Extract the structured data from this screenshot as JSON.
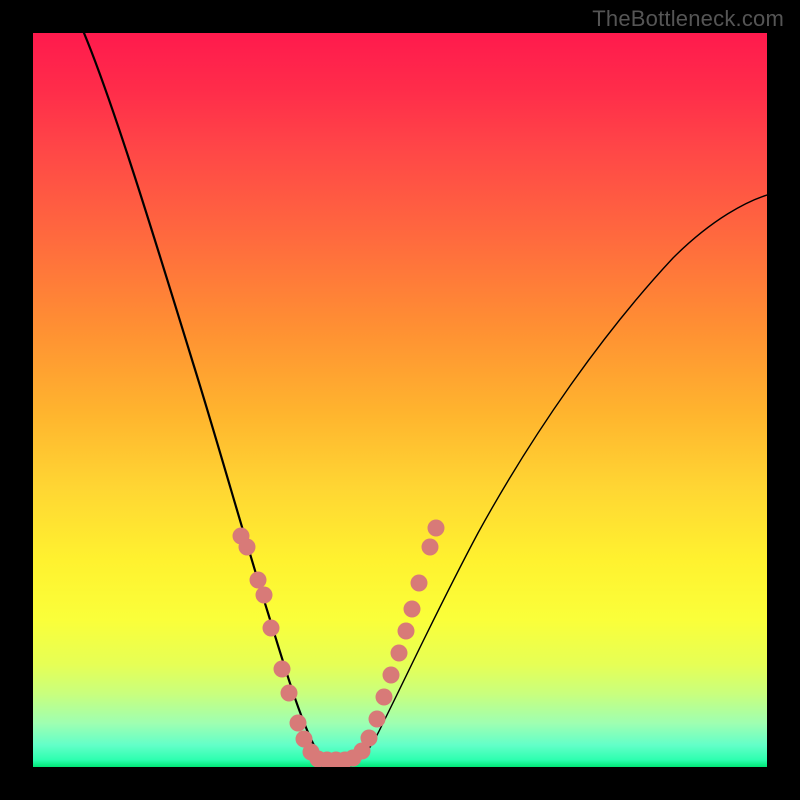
{
  "watermark": "TheBottleneck.com",
  "colors": {
    "frame": "#000000",
    "curve": "#000000",
    "dots": "#d87a78",
    "gradient_top": "#ff1a4d",
    "gradient_mid": "#fff22f",
    "gradient_bottom": "#00e676"
  },
  "chart_data": {
    "type": "line",
    "title": "",
    "xlabel": "",
    "ylabel": "",
    "xlim": [
      0,
      100
    ],
    "ylim": [
      0,
      100
    ],
    "grid": false,
    "legend": "none",
    "series": [
      {
        "name": "left-curve",
        "x": [
          7,
          10,
          13,
          16,
          19,
          22,
          24.5,
          26.5,
          28.5,
          30,
          31.5,
          33,
          34.3,
          35.5,
          36.5,
          37.5,
          38.5
        ],
        "y": [
          100,
          87,
          74.5,
          62,
          50,
          38.5,
          29,
          22,
          16,
          11.5,
          8,
          5,
          3,
          1.8,
          1,
          0.5,
          0.2
        ]
      },
      {
        "name": "right-curve",
        "x": [
          43,
          44.5,
          46,
          48,
          50,
          52.5,
          55,
          58,
          62,
          66,
          71,
          76,
          82,
          88,
          95,
          100
        ],
        "y": [
          0.2,
          1,
          2.5,
          5,
          8.5,
          13,
          18,
          24,
          31.5,
          39,
          47,
          54.5,
          62,
          68.5,
          74,
          77.5
        ]
      }
    ],
    "highlight_points_left": [
      {
        "x": 28.2,
        "y": 31.5
      },
      {
        "x": 29.0,
        "y": 30.0
      },
      {
        "x": 30.5,
        "y": 25.5
      },
      {
        "x": 31.3,
        "y": 23.5
      },
      {
        "x": 32.3,
        "y": 19.0
      },
      {
        "x": 33.8,
        "y": 13.5
      },
      {
        "x": 34.8,
        "y": 10.0
      },
      {
        "x": 36.0,
        "y": 6.0
      },
      {
        "x": 36.8,
        "y": 3.8
      },
      {
        "x": 37.8,
        "y": 2.0
      },
      {
        "x": 38.8,
        "y": 1.2
      },
      {
        "x": 40.0,
        "y": 1.0
      },
      {
        "x": 41.2,
        "y": 1.0
      },
      {
        "x": 42.4,
        "y": 1.0
      }
    ],
    "highlight_points_right": [
      {
        "x": 43.6,
        "y": 1.3
      },
      {
        "x": 44.8,
        "y": 2.2
      },
      {
        "x": 45.8,
        "y": 4.0
      },
      {
        "x": 46.8,
        "y": 6.5
      },
      {
        "x": 47.8,
        "y": 9.5
      },
      {
        "x": 48.8,
        "y": 12.5
      },
      {
        "x": 49.8,
        "y": 15.5
      },
      {
        "x": 50.8,
        "y": 18.5
      },
      {
        "x": 51.6,
        "y": 21.5
      },
      {
        "x": 52.6,
        "y": 25.0
      },
      {
        "x": 54.0,
        "y": 30.0
      },
      {
        "x": 54.8,
        "y": 32.5
      }
    ]
  }
}
